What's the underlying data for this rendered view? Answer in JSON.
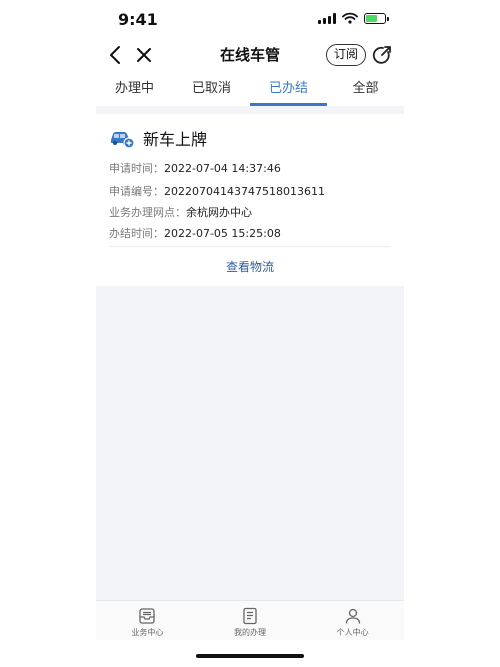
{
  "status_bar": {
    "time": "9:41"
  },
  "nav": {
    "title": "在线车管",
    "subscribe_label": "订阅"
  },
  "tabs": [
    {
      "label": "办理中",
      "active": false
    },
    {
      "label": "已取消",
      "active": false
    },
    {
      "label": "已办结",
      "active": true
    },
    {
      "label": "全部",
      "active": false
    }
  ],
  "card": {
    "title": "新车上牌",
    "icon": "car-icon",
    "rows": [
      {
        "key": "申请时间：",
        "value": "2022-07-04 14:37:46"
      },
      {
        "key": "申请编号：",
        "value": "20220704143747518013611"
      },
      {
        "key": "业务办理网点：",
        "value": "余杭网办中心"
      },
      {
        "key": "办结时间：",
        "value": "2022-07-05 15:25:08"
      }
    ],
    "action_label": "查看物流"
  },
  "tab_bar": [
    {
      "label": "业务中心",
      "icon": "inbox-icon"
    },
    {
      "label": "我的办理",
      "icon": "document-icon"
    },
    {
      "label": "个人中心",
      "icon": "person-icon"
    }
  ],
  "colors": {
    "accent": "#3a77c6",
    "link": "#2f5e9e",
    "background": "#f3f4f9"
  }
}
